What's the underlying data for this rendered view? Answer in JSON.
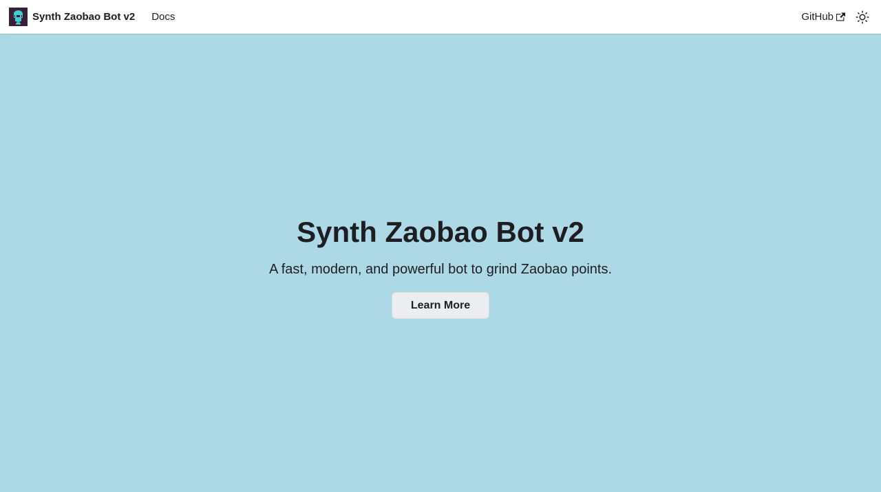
{
  "navbar": {
    "brand_title": "Synth Zaobao Bot v2",
    "links": [
      {
        "label": "Docs"
      }
    ],
    "github_label": "GitHub",
    "icons": {
      "logo": "robot-logo",
      "external": "external-link-icon",
      "theme": "sun-icon"
    }
  },
  "hero": {
    "title": "Synth Zaobao Bot v2",
    "subtitle": "A fast, modern, and powerful bot to grind Zaobao points.",
    "cta_label": "Learn More"
  },
  "colors": {
    "hero_background": "#add8e6",
    "navbar_background": "#ffffff",
    "text": "#1c1e21",
    "button_background": "#ebedf0",
    "logo_background": "#3b1f3a",
    "logo_accent": "#3ecfd0"
  }
}
